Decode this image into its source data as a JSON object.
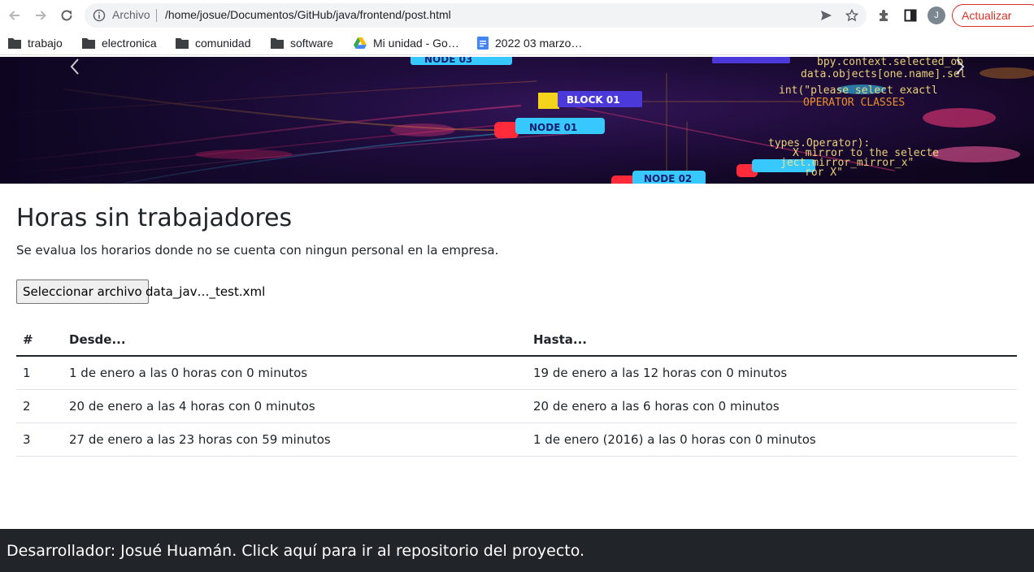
{
  "browser": {
    "omnibox_security_label": "Archivo",
    "url": "/home/josue/Documentos/GitHub/java/frontend/post.html",
    "profile_initial": "J",
    "update_label": "Actualizar"
  },
  "bookmarks": [
    {
      "label": "trabajo",
      "icon": "folder-icon"
    },
    {
      "label": "electronica",
      "icon": "folder-icon"
    },
    {
      "label": "comunidad",
      "icon": "folder-icon"
    },
    {
      "label": "software",
      "icon": "folder-icon"
    },
    {
      "label": "Mi unidad - Go…",
      "icon": "google-drive-icon"
    },
    {
      "label": "2022 03 marzo…",
      "icon": "google-docs-icon"
    }
  ],
  "hero": {
    "labels": [
      "NODE 03",
      "BLOCK 01",
      "NODE 01",
      "NODE 02"
    ],
    "code_lines": [
      "bpy.context.selected_ob",
      "data.objects[one.name].sel",
      "int(\"please select exactl",
      "OPERATOR CLASSES",
      "types.Operator):",
      "X mirror to the selecte",
      "ject.mirror_mirror_x\"",
      "ror X\""
    ]
  },
  "main": {
    "title": "Horas sin trabajadores",
    "description": "Se evalua los horarios donde no se cuenta con ningun personal en la empresa.",
    "file_button": "Seleccionar archivo",
    "file_name": "data_jav…_test.xml"
  },
  "table": {
    "headers": [
      "#",
      "Desde...",
      "Hasta..."
    ],
    "rows": [
      [
        "1",
        "1 de enero a las 0 horas con 0 minutos",
        "19 de enero a las 12 horas con 0 minutos"
      ],
      [
        "2",
        "20 de enero a las 4 horas con 0 minutos",
        "20 de enero a las 6 horas con 0 minutos"
      ],
      [
        "3",
        "27 de enero a las 23 horas con 59 minutos",
        "1 de enero (2016) a las 0 horas con 0 minutos"
      ]
    ]
  },
  "footer": {
    "text": "Desarrollador: Josué Huamán. Click aquí para ir al repositorio del proyecto."
  },
  "colors": {
    "footer_bg": "#212529",
    "update_red": "#d93025",
    "hero_bg": "#150826"
  }
}
